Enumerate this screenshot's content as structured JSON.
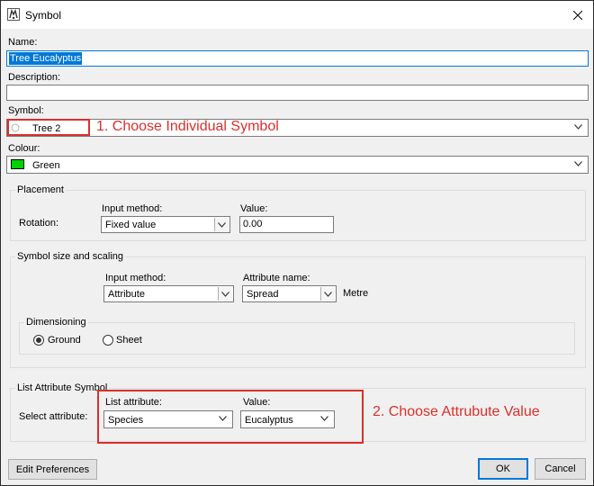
{
  "window": {
    "title": "Symbol",
    "accent": "#0078d7"
  },
  "name": {
    "label": "Name:",
    "value": "Tree Eucalyptus"
  },
  "description": {
    "label": "Description:",
    "value": ""
  },
  "symbol": {
    "label": "Symbol:",
    "value": "Tree 2"
  },
  "colour": {
    "label": "Colour:",
    "value": "Green",
    "swatch": "#00d200"
  },
  "placement": {
    "title": "Placement",
    "rotation_label": "Rotation:",
    "input_method_label": "Input method:",
    "input_method_value": "Fixed value",
    "value_label": "Value:",
    "value": "0.00"
  },
  "symbol_size": {
    "title": "Symbol size and scaling",
    "input_method_label": "Input method:",
    "input_method_value": "Attribute",
    "attribute_name_label": "Attribute name:",
    "attribute_name_value": "Spread",
    "unit": "Metre",
    "dimensioning": {
      "title": "Dimensioning",
      "options": [
        "Ground",
        "Sheet"
      ],
      "selected": "Ground"
    }
  },
  "list_attribute": {
    "title": "List Attribute Symbol",
    "select_label": "Select attribute:",
    "list_attribute_label": "List attribute:",
    "list_attribute_value": "Species",
    "value_label": "Value:",
    "value": "Eucalyptus"
  },
  "buttons": {
    "edit_preferences": "Edit Preferences",
    "ok": "OK",
    "cancel": "Cancel"
  },
  "annotations": {
    "step1": "1. Choose Individual Symbol",
    "step2": "2. Choose Attrubute Value",
    "color": "#d9302c"
  }
}
